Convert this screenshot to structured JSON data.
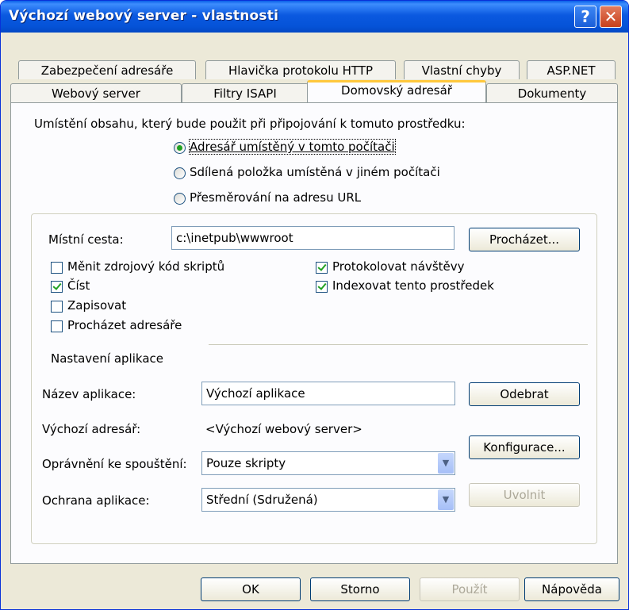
{
  "window": {
    "title": "Výchozí webový server - vlastnosti",
    "help_icon": "?",
    "close_icon": "✕"
  },
  "tabs_row1": [
    "Zabezpečení adresáře",
    "Hlavička protokolu HTTP",
    "Vlastní chyby",
    "ASP.NET"
  ],
  "tabs_row2": [
    "Webový server",
    "Filtry ISAPI",
    "Domovský adresář",
    "Dokumenty"
  ],
  "content_location": {
    "prompt": "Umístění obsahu, který bude použit při připojování k tomuto prostředku:",
    "options": [
      {
        "label": "Adresář umístěný v tomto počítači",
        "selected": true
      },
      {
        "label": "Sdílená položka umístěná v jiném počítači",
        "selected": false
      },
      {
        "label": "Přesměrování na adresu URL",
        "selected": false
      }
    ]
  },
  "local_path": {
    "label": "Místní cesta:",
    "value": "c:\\inetpub\\wwwroot",
    "browse_button": "Procházet..."
  },
  "checkboxes": {
    "script_source": {
      "label": "Měnit zdrojový kód skriptů",
      "checked": false
    },
    "read": {
      "label": "Číst",
      "checked": true
    },
    "write": {
      "label": "Zapisovat",
      "checked": false
    },
    "browse_dir": {
      "label": "Procházet adresáře",
      "checked": false
    },
    "log_visits": {
      "label": "Protokolovat návštěvy",
      "checked": true
    },
    "index": {
      "label": "Indexovat tento prostředek",
      "checked": true
    }
  },
  "app_settings": {
    "heading": "Nastavení aplikace",
    "name_label": "Název aplikace:",
    "name_value": "Výchozí aplikace",
    "remove_button": "Odebrat",
    "start_dir_label": "Výchozí adresář:",
    "start_dir_value": "<Výchozí webový server>",
    "config_button": "Konfigurace...",
    "exec_perm_label": "Oprávnění ke spouštění:",
    "exec_perm_value": "Pouze skripty",
    "protection_label": "Ochrana aplikace:",
    "protection_value": "Střední (Sdružená)",
    "unload_button": "Uvolnit"
  },
  "buttons": {
    "ok": "OK",
    "cancel": "Storno",
    "apply": "Použít",
    "help": "Nápověda"
  },
  "colors": {
    "titlebar": "#0553d8",
    "active_tab_accent": "#ffc83c",
    "dialog_bg": "#ece9d8",
    "check_mark": "#21a121"
  }
}
